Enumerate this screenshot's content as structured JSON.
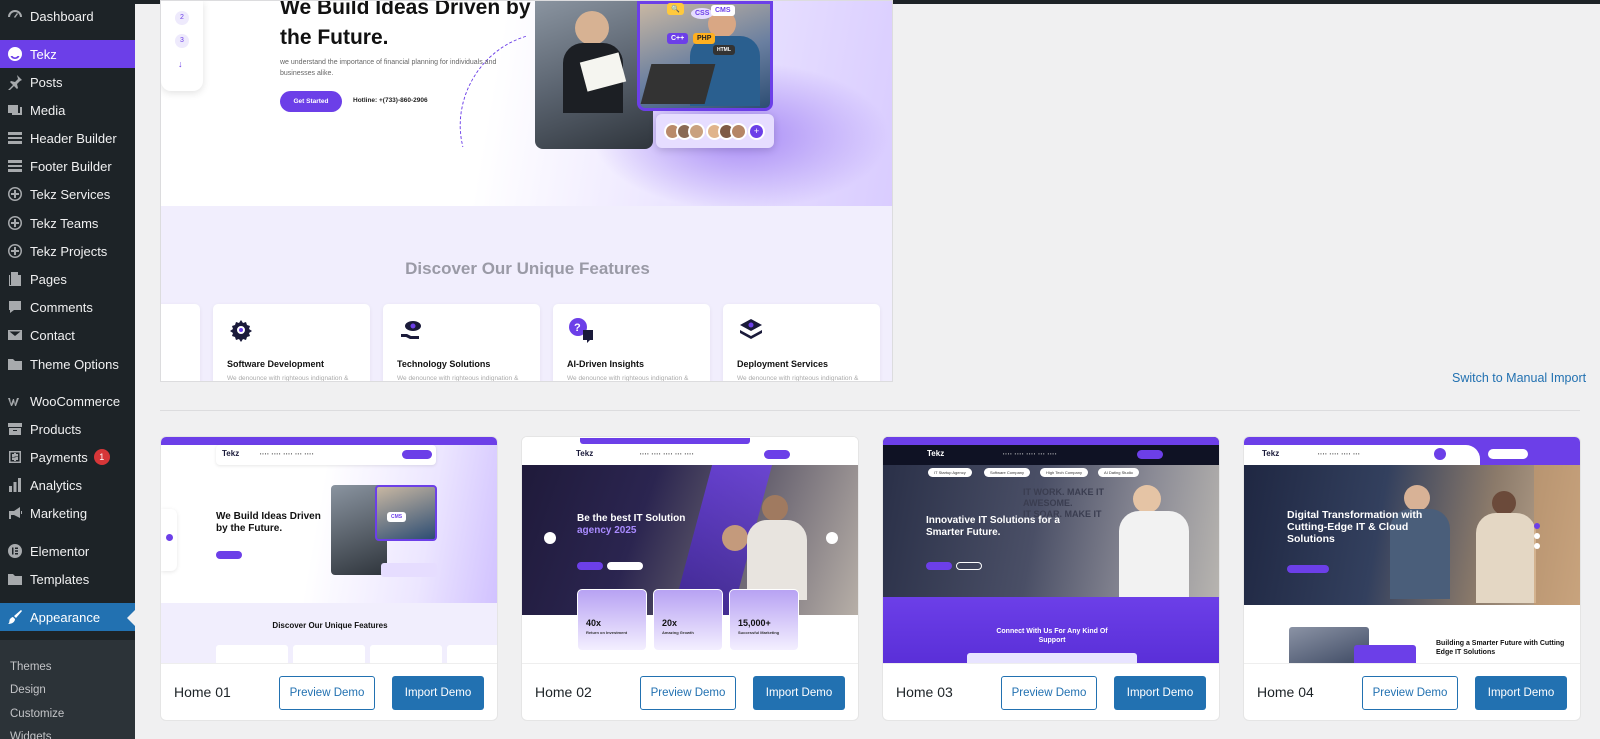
{
  "sidebar": {
    "items": [
      {
        "label": "Dashboard",
        "icon": "dashboard-icon"
      },
      {
        "label": "Tekz",
        "icon": "tekz-icon"
      },
      {
        "label": "Posts",
        "icon": "pin-icon"
      },
      {
        "label": "Media",
        "icon": "media-icon"
      },
      {
        "label": "Header Builder",
        "icon": "layout-icon"
      },
      {
        "label": "Footer Builder",
        "icon": "layout-icon"
      },
      {
        "label": "Tekz Services",
        "icon": "plus-circle-icon"
      },
      {
        "label": "Tekz Teams",
        "icon": "plus-circle-icon"
      },
      {
        "label": "Tekz Projects",
        "icon": "plus-circle-icon"
      },
      {
        "label": "Pages",
        "icon": "pages-icon"
      },
      {
        "label": "Comments",
        "icon": "comment-icon"
      },
      {
        "label": "Contact",
        "icon": "mail-icon"
      },
      {
        "label": "Theme Options",
        "icon": "folder-icon"
      },
      {
        "label": "WooCommerce",
        "icon": "woo-icon"
      },
      {
        "label": "Products",
        "icon": "archive-icon"
      },
      {
        "label": "Payments",
        "icon": "dollar-icon",
        "badge": "1"
      },
      {
        "label": "Analytics",
        "icon": "bar-chart-icon"
      },
      {
        "label": "Marketing",
        "icon": "megaphone-icon"
      },
      {
        "label": "Elementor",
        "icon": "elementor-icon"
      },
      {
        "label": "Templates",
        "icon": "folder-icon"
      },
      {
        "label": "Appearance",
        "icon": "brush-icon"
      }
    ],
    "submenu": [
      "Themes",
      "Design",
      "Customize",
      "Widgets"
    ]
  },
  "preview": {
    "hero_title": "We Build Ideas Driven by the Future.",
    "hero_desc": "we understand the importance of financial planning for individuals and businesses alike.",
    "cta": "Get Started",
    "hotline": "Hotline: +(733)-860-2906",
    "pager": [
      "2",
      "3"
    ],
    "tags": [
      "CMS",
      "CSS",
      "C++",
      "PHP",
      "HTML"
    ],
    "features_heading": "Discover Our Unique Features",
    "features": [
      {
        "title": "Software Development",
        "desc": "We denounce with righteous indignation &",
        "icon": "gear-circuit-icon"
      },
      {
        "title": "Technology Solutions",
        "desc": "We denounce with righteous indignation &",
        "icon": "hand-eye-icon"
      },
      {
        "title": "AI-Driven Insights",
        "desc": "We denounce with righteous indignation &",
        "icon": "question-chat-icon"
      },
      {
        "title": "Deployment Services",
        "desc": "We denounce with righteous indignation &",
        "icon": "layers-icon"
      }
    ]
  },
  "switch_link": "Switch to Manual Import",
  "demos": [
    {
      "name": "Home 01",
      "preview": "Preview Demo",
      "import": "Import Demo",
      "logo": "Tekz",
      "title": "We Build Ideas Driven by the Future.",
      "feature_heading": "Discover Our Unique Features",
      "tags": [
        "CMS"
      ]
    },
    {
      "name": "Home 02",
      "preview": "Preview Demo",
      "import": "Import Demo",
      "logo": "Tekz",
      "title": "Be the best IT Solution",
      "title_accent": "agency 2025",
      "stats": [
        {
          "value": "40x",
          "label": "Return on Investment"
        },
        {
          "value": "20x",
          "label": "Amazing Growth"
        },
        {
          "value": "15,000+",
          "label": "Successful Marketing"
        }
      ]
    },
    {
      "name": "Home 03",
      "preview": "Preview Demo",
      "import": "Import Demo",
      "logo": "Tekz",
      "title": "Innovative IT Solutions for a Smarter Future.",
      "chips": [
        "IT Startup Agency",
        "Software Company",
        "High Tech Company",
        "AI Dating Studio"
      ],
      "bottom": "Connect With Us For Any Kind Of Support"
    },
    {
      "name": "Home 04",
      "preview": "Preview Demo",
      "import": "Import Demo",
      "logo": "Tekz",
      "title": "Digital Transformation with Cutting-Edge IT & Cloud Solutions",
      "bottom": "Building a Smarter Future with Cutting Edge IT Solutions"
    }
  ]
}
